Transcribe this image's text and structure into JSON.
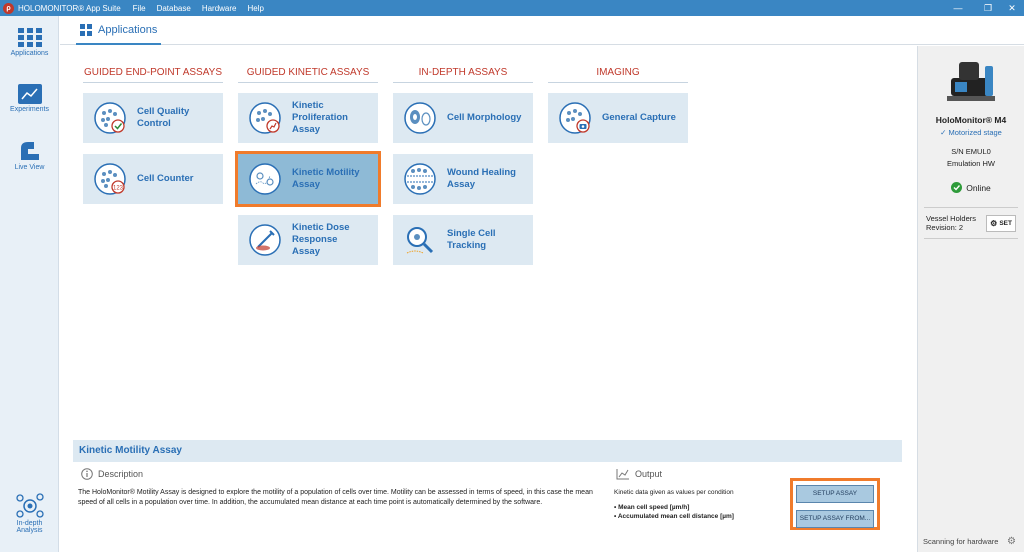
{
  "titlebar": {
    "app_title": "HOLOMONITOR® App Suite",
    "menus": [
      "File",
      "Database",
      "Hardware",
      "Help"
    ]
  },
  "nav": {
    "applications": "Applications",
    "experiments": "Experiments",
    "live_view": "Live View",
    "indepth": "In-depth Analysis"
  },
  "header": {
    "tab_label": "Applications"
  },
  "categories": [
    {
      "title": "GUIDED END-POINT ASSAYS"
    },
    {
      "title": "GUIDED KINETIC ASSAYS"
    },
    {
      "title": "IN-DEPTH ASSAYS"
    },
    {
      "title": "IMAGING"
    }
  ],
  "tiles": {
    "cell_quality": "Cell Quality Control",
    "cell_counter": "Cell Counter",
    "kinetic_proliferation": "Kinetic Proliferation Assay",
    "kinetic_motility": "Kinetic Motility Assay",
    "kinetic_dose": "Kinetic Dose Response Assay",
    "cell_morphology": "Cell Morphology",
    "wound_healing": "Wound Healing Assay",
    "single_cell": "Single Cell Tracking",
    "general_capture": "General Capture"
  },
  "device": {
    "name": "HoloMonitor® M4",
    "stage": "✓ Motorized stage",
    "serial": "S/N EMUL0",
    "emulation": "Emulation HW",
    "status": "Online",
    "vessel_label": "Vessel Holders",
    "revision": "Revision: 2",
    "set_label": "SET"
  },
  "info": {
    "title": "Kinetic Motility Assay",
    "description_head": "Description",
    "description": "The HoloMonitor® Motility Assay is designed to explore the motility of a population of cells over time. Motility can be assessed in terms of speed, in this case the mean speed of all cells in a population over time. In addition, the accumulated mean distance at each time point is automatically determined by the software.",
    "output_head": "Output",
    "output_intro": "Kinetic data given as values per condition",
    "output_items": [
      "Mean cell speed [µm/h]",
      "Accumulated mean cell distance [µm]"
    ],
    "setup_button": "SETUP ASSAY",
    "setup_from_button": "SETUP ASSAY FROM..."
  },
  "status": {
    "text": "Scanning for hardware"
  }
}
